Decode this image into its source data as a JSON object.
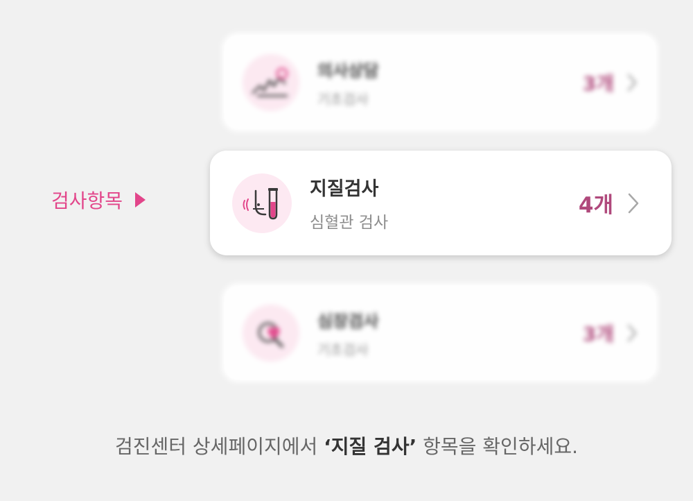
{
  "side_label": "검사항목",
  "cards": [
    {
      "title": "의사상담",
      "subtitle": "기초검사",
      "count": "3개"
    },
    {
      "title": "지질검사",
      "subtitle": "심혈관 검사",
      "count": "4개"
    },
    {
      "title": "심장검사",
      "subtitle": "기초검사",
      "count": "3개"
    }
  ],
  "instruction": {
    "before": "검진센터 상세페이지에서 ",
    "emphasis": "‘지질 검사’",
    "after": " 항목을 확인하세요."
  },
  "colors": {
    "accent_pink": "#e2458a",
    "count_color": "#b0497c",
    "icon_bg": "#fde9f2",
    "background": "#f1f1f1"
  }
}
